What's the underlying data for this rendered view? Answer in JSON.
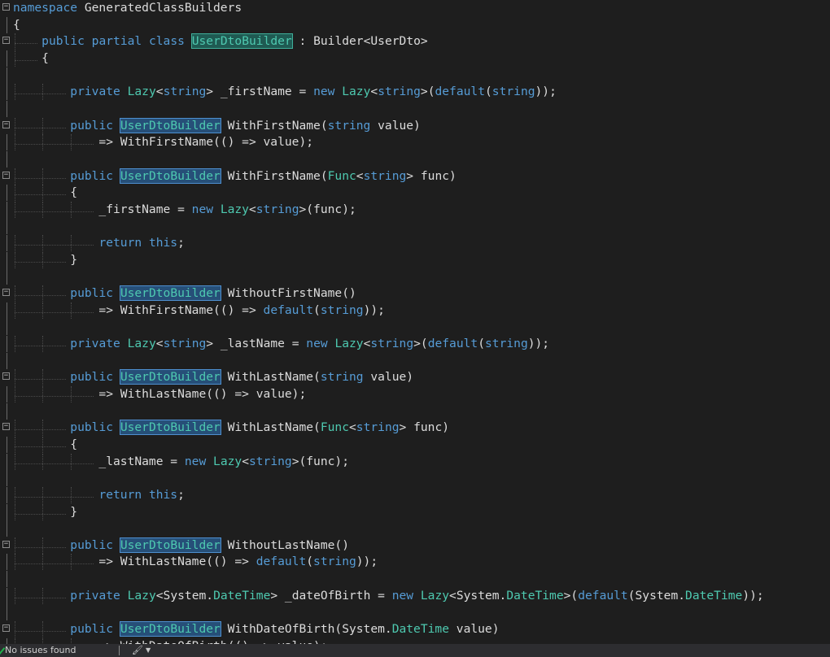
{
  "editor": {
    "lines": [
      {
        "fold": "minus",
        "tokens": [
          [
            "kw",
            "namespace"
          ],
          [
            "tx",
            " GeneratedClassBuilders"
          ]
        ]
      },
      {
        "fold": "line",
        "tokens": [
          [
            "tx",
            "{"
          ]
        ]
      },
      {
        "fold": "minus",
        "tokens": [
          [
            "tx",
            "    "
          ],
          [
            "kw",
            "public"
          ],
          [
            "tx",
            " "
          ],
          [
            "kw",
            "partial"
          ],
          [
            "tx",
            " "
          ],
          [
            "kw",
            "class"
          ],
          [
            "tx",
            " "
          ],
          [
            "hl2",
            "UserDtoBuilder"
          ],
          [
            "tx",
            " : Builder<UserDto>"
          ]
        ]
      },
      {
        "fold": "line",
        "tokens": [
          [
            "tx",
            "    {"
          ]
        ]
      },
      {
        "fold": "line",
        "tokens": []
      },
      {
        "fold": "line",
        "tokens": [
          [
            "tx",
            "        "
          ],
          [
            "kw",
            "private"
          ],
          [
            "tx",
            " "
          ],
          [
            "ty",
            "Lazy"
          ],
          [
            "tx",
            "<"
          ],
          [
            "kw",
            "string"
          ],
          [
            "tx",
            "> _firstName = "
          ],
          [
            "kw",
            "new"
          ],
          [
            "tx",
            " "
          ],
          [
            "ty",
            "Lazy"
          ],
          [
            "tx",
            "<"
          ],
          [
            "kw",
            "string"
          ],
          [
            "tx",
            ">("
          ],
          [
            "kw",
            "default"
          ],
          [
            "tx",
            "("
          ],
          [
            "kw",
            "string"
          ],
          [
            "tx",
            "));"
          ]
        ]
      },
      {
        "fold": "line",
        "tokens": []
      },
      {
        "fold": "minus",
        "tokens": [
          [
            "tx",
            "        "
          ],
          [
            "kw",
            "public"
          ],
          [
            "tx",
            " "
          ],
          [
            "hl",
            "UserDtoBuilder"
          ],
          [
            "tx",
            " WithFirstName("
          ],
          [
            "kw",
            "string"
          ],
          [
            "tx",
            " value)"
          ]
        ]
      },
      {
        "fold": "line",
        "tokens": [
          [
            "tx",
            "            => WithFirstName(() => value);"
          ]
        ]
      },
      {
        "fold": "line",
        "tokens": []
      },
      {
        "fold": "minus",
        "tokens": [
          [
            "tx",
            "        "
          ],
          [
            "kw",
            "public"
          ],
          [
            "tx",
            " "
          ],
          [
            "hl",
            "UserDtoBuilder"
          ],
          [
            "tx",
            " WithFirstName("
          ],
          [
            "ty",
            "Func"
          ],
          [
            "tx",
            "<"
          ],
          [
            "kw",
            "string"
          ],
          [
            "tx",
            "> func)"
          ]
        ]
      },
      {
        "fold": "line",
        "tokens": [
          [
            "tx",
            "        {"
          ]
        ]
      },
      {
        "fold": "line",
        "tokens": [
          [
            "tx",
            "            _firstName = "
          ],
          [
            "kw",
            "new"
          ],
          [
            "tx",
            " "
          ],
          [
            "ty",
            "Lazy"
          ],
          [
            "tx",
            "<"
          ],
          [
            "kw",
            "string"
          ],
          [
            "tx",
            ">(func);"
          ]
        ]
      },
      {
        "fold": "line",
        "tokens": []
      },
      {
        "fold": "line",
        "tokens": [
          [
            "tx",
            "            "
          ],
          [
            "kw",
            "return"
          ],
          [
            "tx",
            " "
          ],
          [
            "kw",
            "this"
          ],
          [
            "tx",
            ";"
          ]
        ]
      },
      {
        "fold": "line",
        "tokens": [
          [
            "tx",
            "        }"
          ]
        ]
      },
      {
        "fold": "line",
        "tokens": []
      },
      {
        "fold": "minus",
        "tokens": [
          [
            "tx",
            "        "
          ],
          [
            "kw",
            "public"
          ],
          [
            "tx",
            " "
          ],
          [
            "hl",
            "UserDtoBuilder"
          ],
          [
            "tx",
            " WithoutFirstName()"
          ]
        ]
      },
      {
        "fold": "line",
        "tokens": [
          [
            "tx",
            "            => WithFirstName(() => "
          ],
          [
            "kw",
            "default"
          ],
          [
            "tx",
            "("
          ],
          [
            "kw",
            "string"
          ],
          [
            "tx",
            "));"
          ]
        ]
      },
      {
        "fold": "line",
        "tokens": []
      },
      {
        "fold": "line",
        "tokens": [
          [
            "tx",
            "        "
          ],
          [
            "kw",
            "private"
          ],
          [
            "tx",
            " "
          ],
          [
            "ty",
            "Lazy"
          ],
          [
            "tx",
            "<"
          ],
          [
            "kw",
            "string"
          ],
          [
            "tx",
            "> _lastName = "
          ],
          [
            "kw",
            "new"
          ],
          [
            "tx",
            " "
          ],
          [
            "ty",
            "Lazy"
          ],
          [
            "tx",
            "<"
          ],
          [
            "kw",
            "string"
          ],
          [
            "tx",
            ">("
          ],
          [
            "kw",
            "default"
          ],
          [
            "tx",
            "("
          ],
          [
            "kw",
            "string"
          ],
          [
            "tx",
            "));"
          ]
        ]
      },
      {
        "fold": "line",
        "tokens": []
      },
      {
        "fold": "minus",
        "tokens": [
          [
            "tx",
            "        "
          ],
          [
            "kw",
            "public"
          ],
          [
            "tx",
            " "
          ],
          [
            "hl",
            "UserDtoBuilder"
          ],
          [
            "tx",
            " WithLastName("
          ],
          [
            "kw",
            "string"
          ],
          [
            "tx",
            " value)"
          ]
        ]
      },
      {
        "fold": "line",
        "tokens": [
          [
            "tx",
            "            => WithLastName(() => value);"
          ]
        ]
      },
      {
        "fold": "line",
        "tokens": []
      },
      {
        "fold": "minus",
        "tokens": [
          [
            "tx",
            "        "
          ],
          [
            "kw",
            "public"
          ],
          [
            "tx",
            " "
          ],
          [
            "hl",
            "UserDtoBuilder"
          ],
          [
            "tx",
            " WithLastName("
          ],
          [
            "ty",
            "Func"
          ],
          [
            "tx",
            "<"
          ],
          [
            "kw",
            "string"
          ],
          [
            "tx",
            "> func)"
          ]
        ]
      },
      {
        "fold": "line",
        "tokens": [
          [
            "tx",
            "        {"
          ]
        ]
      },
      {
        "fold": "line",
        "tokens": [
          [
            "tx",
            "            _lastName = "
          ],
          [
            "kw",
            "new"
          ],
          [
            "tx",
            " "
          ],
          [
            "ty",
            "Lazy"
          ],
          [
            "tx",
            "<"
          ],
          [
            "kw",
            "string"
          ],
          [
            "tx",
            ">(func);"
          ]
        ]
      },
      {
        "fold": "line",
        "tokens": []
      },
      {
        "fold": "line",
        "tokens": [
          [
            "tx",
            "            "
          ],
          [
            "kw",
            "return"
          ],
          [
            "tx",
            " "
          ],
          [
            "kw",
            "this"
          ],
          [
            "tx",
            ";"
          ]
        ]
      },
      {
        "fold": "line",
        "tokens": [
          [
            "tx",
            "        }"
          ]
        ]
      },
      {
        "fold": "line",
        "tokens": []
      },
      {
        "fold": "minus",
        "tokens": [
          [
            "tx",
            "        "
          ],
          [
            "kw",
            "public"
          ],
          [
            "tx",
            " "
          ],
          [
            "hl",
            "UserDtoBuilder"
          ],
          [
            "tx",
            " WithoutLastName()"
          ]
        ]
      },
      {
        "fold": "line",
        "tokens": [
          [
            "tx",
            "            => WithLastName(() => "
          ],
          [
            "kw",
            "default"
          ],
          [
            "tx",
            "("
          ],
          [
            "kw",
            "string"
          ],
          [
            "tx",
            "));"
          ]
        ]
      },
      {
        "fold": "line",
        "tokens": []
      },
      {
        "fold": "line",
        "tokens": [
          [
            "tx",
            "        "
          ],
          [
            "kw",
            "private"
          ],
          [
            "tx",
            " "
          ],
          [
            "ty",
            "Lazy"
          ],
          [
            "tx",
            "<System."
          ],
          [
            "ty",
            "DateTime"
          ],
          [
            "tx",
            "> _dateOfBirth = "
          ],
          [
            "kw",
            "new"
          ],
          [
            "tx",
            " "
          ],
          [
            "ty",
            "Lazy"
          ],
          [
            "tx",
            "<System."
          ],
          [
            "ty",
            "DateTime"
          ],
          [
            "tx",
            ">("
          ],
          [
            "kw",
            "default"
          ],
          [
            "tx",
            "(System."
          ],
          [
            "ty",
            "DateTime"
          ],
          [
            "tx",
            "));"
          ]
        ]
      },
      {
        "fold": "line",
        "tokens": []
      },
      {
        "fold": "minus",
        "tokens": [
          [
            "tx",
            "        "
          ],
          [
            "kw",
            "public"
          ],
          [
            "tx",
            " "
          ],
          [
            "hl",
            "UserDtoBuilder"
          ],
          [
            "tx",
            " WithDateOfBirth(System."
          ],
          [
            "ty",
            "DateTime"
          ],
          [
            "tx",
            " value)"
          ]
        ]
      },
      {
        "fold": "line",
        "tokens": [
          [
            "tx",
            "            => WithDateOfBirth(() => value);"
          ]
        ]
      }
    ]
  },
  "status": {
    "text": "No issues found",
    "icon": "check-icon",
    "tool_icon": "code-cleanup-icon"
  },
  "colors": {
    "background": "#1e1e1e",
    "keyword": "#569cd6",
    "type": "#4ec9b0",
    "text": "#dcdcdc",
    "status_ok": "#1fb04a"
  }
}
